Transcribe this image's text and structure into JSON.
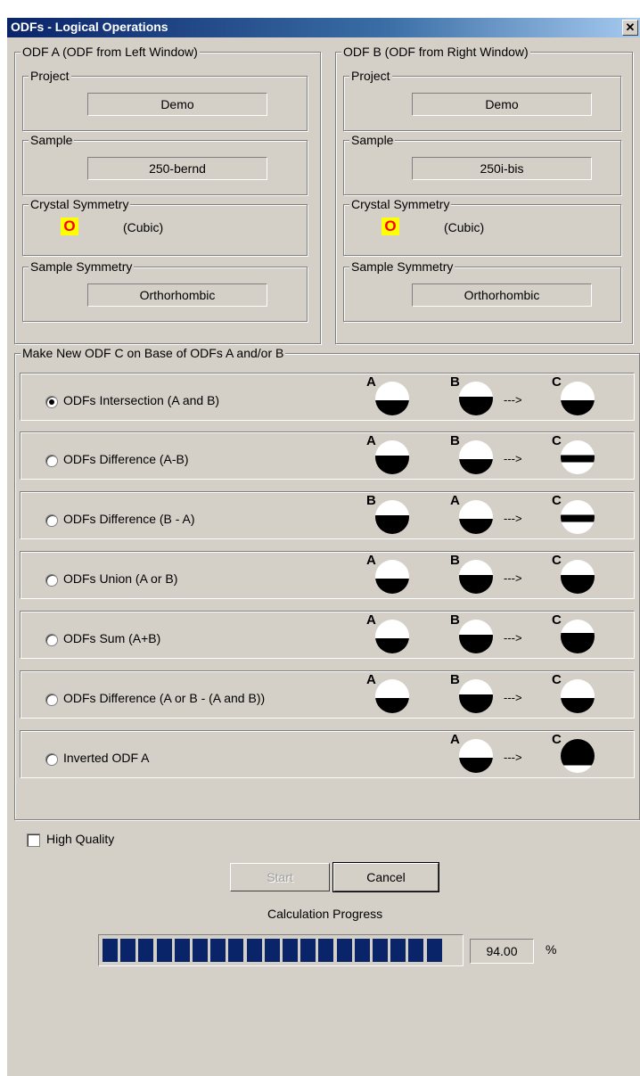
{
  "window": {
    "title": "ODFs - Logical Operations",
    "close_glyph": "✕"
  },
  "odf_a": {
    "group_label": "ODF A  (ODF from Left Window)",
    "project_label": "Project",
    "project_value": "Demo",
    "sample_label": "Sample",
    "sample_value": "250-bernd",
    "crystal_label": "Crystal Symmetry",
    "crystal_icon": "O",
    "crystal_value": "(Cubic)",
    "sample_sym_label": "Sample Symmetry",
    "sample_sym_value": "Orthorhombic"
  },
  "odf_b": {
    "group_label": "ODF B  (ODF from Right Window)",
    "project_label": "Project",
    "project_value": "Demo",
    "sample_label": "Sample",
    "sample_value": "250i-bis",
    "crystal_label": "Crystal Symmetry",
    "crystal_icon": "O",
    "crystal_value": "(Cubic)",
    "sample_sym_label": "Sample Symmetry",
    "sample_sym_value": "Orthorhombic"
  },
  "operations": {
    "group_label": "Make New ODF C on Base of ODFs A and/or B",
    "selected_index": 0,
    "arrow": "--->",
    "items": [
      {
        "label": "ODFs Intersection (A and B)",
        "icons": [
          [
            "A",
            "h1"
          ],
          [
            "B",
            "h2"
          ],
          [
            "C",
            "h1"
          ]
        ]
      },
      {
        "label": "ODFs  Difference  (A-B)",
        "icons": [
          [
            "A",
            "h2"
          ],
          [
            "B",
            "h1"
          ],
          [
            "C",
            "bar"
          ]
        ]
      },
      {
        "label": "ODFs  Difference  (B - A)",
        "icons": [
          [
            "B",
            "h2"
          ],
          [
            "A",
            "h1"
          ],
          [
            "C",
            "bar"
          ]
        ]
      },
      {
        "label": "ODFs  Union (A or B)",
        "icons": [
          [
            "A",
            "h1"
          ],
          [
            "B",
            "h2"
          ],
          [
            "C",
            "h2"
          ]
        ]
      },
      {
        "label": "ODFs Sum (A+B)",
        "icons": [
          [
            "A",
            "h1"
          ],
          [
            "B",
            "h2"
          ],
          [
            "C",
            "h3"
          ]
        ]
      },
      {
        "label": "ODFs  Difference (A or B - (A and B))",
        "icons": [
          [
            "A",
            "h1"
          ],
          [
            "B",
            "h2"
          ],
          [
            "C",
            "h1"
          ]
        ]
      },
      {
        "label": "Inverted ODF A",
        "icons": [
          [
            "A",
            "h1"
          ],
          [
            "C",
            "inv"
          ]
        ]
      }
    ]
  },
  "high_quality_label": "High Quality",
  "high_quality_checked": false,
  "buttons": {
    "start": "Start",
    "cancel": "Cancel"
  },
  "progress": {
    "label": "Calculation Progress",
    "value_text": "94.00",
    "unit": "%",
    "fraction": 0.94
  },
  "colors": {
    "title_bar": "#0a246a",
    "progress_fill": "#0a246a",
    "crystal_icon_bg": "#ffff00",
    "crystal_icon_fg": "#ff0000"
  }
}
